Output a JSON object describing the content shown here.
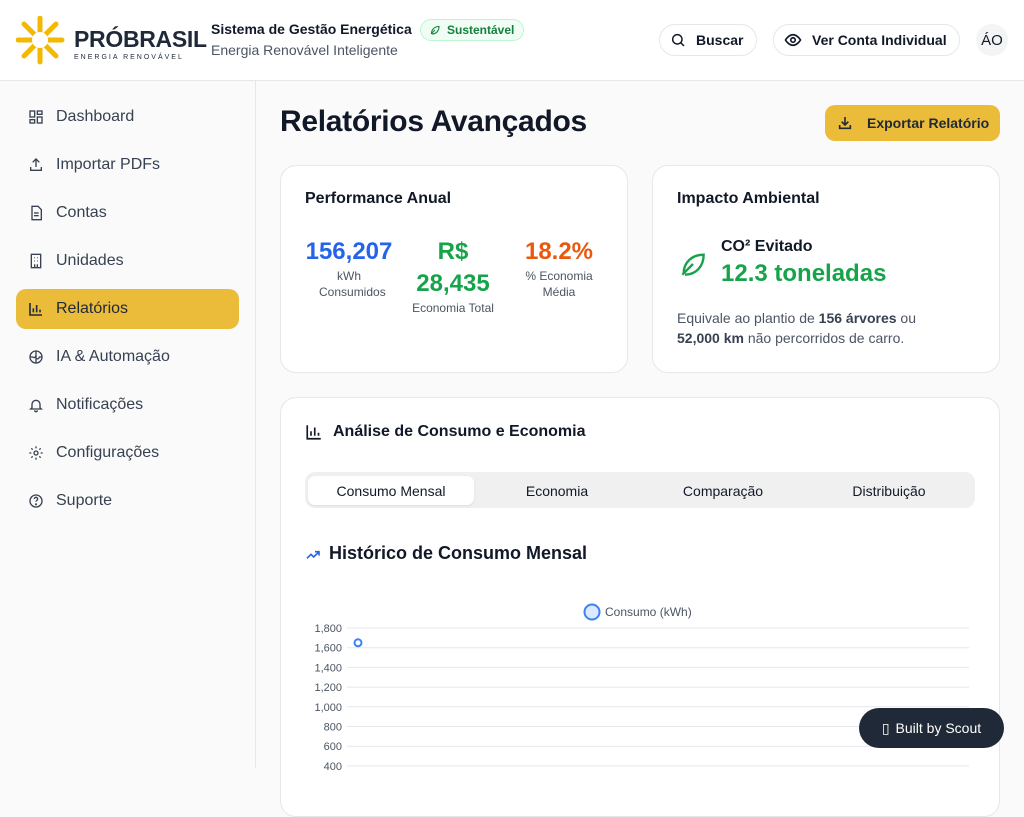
{
  "header": {
    "logo_text": "PRÓBRASIL",
    "logo_sub": "ENERGIA RENOVÁVEL",
    "app_title": "Sistema de Gestão Energética",
    "badge": "Sustentável",
    "app_subtitle": "Energia Renovável Inteligente",
    "search_label": "Buscar",
    "view_account_label": "Ver Conta Individual",
    "avatar_initials": "ÁO"
  },
  "sidebar": {
    "items": [
      {
        "label": "Dashboard",
        "icon": "grid-icon"
      },
      {
        "label": "Importar PDFs",
        "icon": "upload-icon"
      },
      {
        "label": "Contas",
        "icon": "document-icon"
      },
      {
        "label": "Unidades",
        "icon": "building-icon"
      },
      {
        "label": "Relatórios",
        "icon": "bar-chart-icon",
        "active": true
      },
      {
        "label": "IA & Automação",
        "icon": "brain-icon"
      },
      {
        "label": "Notificações",
        "icon": "bell-icon"
      },
      {
        "label": "Configurações",
        "icon": "gear-icon"
      },
      {
        "label": "Suporte",
        "icon": "help-circle-icon"
      }
    ]
  },
  "main": {
    "page_title": "Relatórios Avançados",
    "export_label": "Exportar Relatório",
    "performance": {
      "title": "Performance Anual",
      "stats": [
        {
          "value": "156,207",
          "label": "kWh Consumidos",
          "color": "#2563eb"
        },
        {
          "value": "R$ 28,435",
          "label": "Economia Total",
          "color": "#16a34a"
        },
        {
          "value": "18.2%",
          "label": "% Economia Média",
          "color": "#ea580c"
        }
      ]
    },
    "impact": {
      "title": "Impacto Ambiental",
      "co2_label": "CO² Evitado",
      "co2_value": "12.3 toneladas",
      "desc_pre": "Equivale ao plantio de ",
      "desc_trees": "156 árvores",
      "desc_mid": " ou ",
      "desc_km": "52,000 km",
      "desc_post": " não percorridos de carro."
    },
    "analysis": {
      "title": "Análise de Consumo e Economia",
      "tabs": [
        "Consumo Mensal",
        "Economia",
        "Comparação",
        "Distribuição"
      ],
      "active_tab": 0,
      "section_title": "Histórico de Consumo Mensal"
    }
  },
  "chart_data": {
    "type": "line",
    "series": [
      {
        "name": "Consumo (kWh)",
        "values": [
          1650
        ],
        "color": "#3b82f6"
      }
    ],
    "y_ticks": [
      "1,800",
      "1,600",
      "1,400",
      "1,200",
      "1,000",
      "800",
      "600",
      "400"
    ],
    "ylim": [
      400,
      1800
    ],
    "grid": true,
    "legend_position": "top-center"
  },
  "footer_badge": "Built by Scout"
}
